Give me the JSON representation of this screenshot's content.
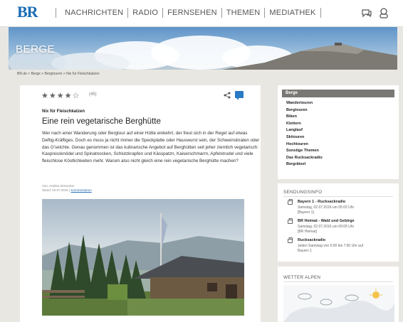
{
  "header": {
    "logo": "BR",
    "nav": [
      "NACHRICHTEN",
      "RADIO",
      "FERNSEHEN",
      "THEMEN",
      "MEDIATHEK"
    ]
  },
  "banner": {
    "title": "BERGE"
  },
  "breadcrumb": "BR.de > Berge > Bergtouren > Nix für Fleischkatzen",
  "article": {
    "rating": 4,
    "rating_count": "(45)",
    "kicker": "Nix für Fleischkatzen",
    "headline": "Eine rein vegetarische Berghütte",
    "body": "Wer nach einer Wanderung oder Bergtour auf einer Hütte einkehrt, der freut sich in der Regel auf etwas Deftig-Kräftiges. Doch es muss ja nicht immer die Speckplatte oder Hauswurst sein, der Schweinsbraten oder das G'selchte. Genau genommen ist das kulinarische Angebot auf Berghütten seit jeher ziemlich vegetarisch: Kaspressknödel und Spinatnocken, Schlutzkrapfen und Kässpatzn, Kaiserschmarrn, Apfelstrudel und viele fleischlose Köstlichkeiten mehr. Warum also nicht gleich eine rein vegetarische Berghütte machen?",
    "author": "Von: Andrea Zinnecker",
    "date": "Stand: 02.07.2016",
    "comments_link": "Kommentieren"
  },
  "sidebar": {
    "header": "Berge",
    "items": [
      "Wandertouren",
      "Bergtouren",
      "Biken",
      "Klettern",
      "Langlauf",
      "Skitouren",
      "Hochtouren",
      "Sonstige Themen",
      "Das Rucksackradio",
      "Bergrätsel"
    ]
  },
  "sendungsinfo": {
    "title": "SENDUNGSINFO",
    "entries": [
      {
        "title": "Bayern 1 - Rucksackradio",
        "lines": [
          "Samstag, 02.07.2016 um 05:02 Uhr",
          "[Bayern 1]"
        ]
      },
      {
        "title": "BR Heimat - Wald und Gebirge",
        "lines": [
          "Samstag, 02.07.2016 um 09:05 Uhr",
          "[BR Heimat]"
        ]
      },
      {
        "title": "Rucksackradio",
        "lines": [
          "Jeden Samstag von 5:00 bis 7:00 Uhr auf",
          "Bayern 1"
        ]
      }
    ]
  },
  "weather": {
    "title": "WETTER ALPEN"
  },
  "colors": {
    "brand": "#1a6cb5",
    "accent": "#2a7ac4",
    "sidebar_header": "#7a7874"
  },
  "icons": [
    "share-icon",
    "comment-icon",
    "radio-icon",
    "weather-icon",
    "user-icon"
  ]
}
